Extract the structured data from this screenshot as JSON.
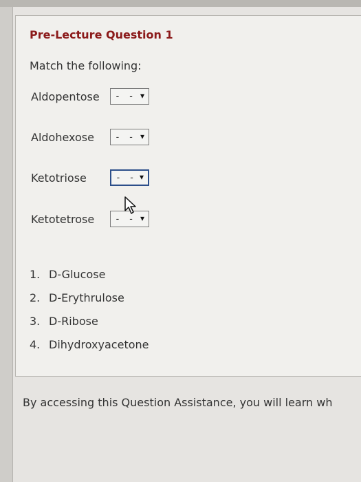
{
  "question": {
    "title": "Pre-Lecture Question 1",
    "instructions": "Match the following:"
  },
  "match_rows": [
    {
      "label": "Aldopentose",
      "selected": "- -"
    },
    {
      "label": "Aldohexose",
      "selected": "- -"
    },
    {
      "label": "Ketotriose",
      "selected": "- -"
    },
    {
      "label": "Ketotetrose",
      "selected": "- -"
    }
  ],
  "options": [
    {
      "number": "1.",
      "text": "D-Glucose"
    },
    {
      "number": "2.",
      "text": "D-Erythrulose"
    },
    {
      "number": "3.",
      "text": "D-Ribose"
    },
    {
      "number": "4.",
      "text": "Dihydroxyacetone"
    }
  ],
  "footer": {
    "text": "By accessing this Question Assistance, you will learn wh"
  },
  "colors": {
    "title": "#8b1a1a",
    "focus_border": "#2c4f8a"
  },
  "icons": {
    "dropdown": "chevron-down-icon",
    "cursor": "mouse-pointer-icon"
  }
}
